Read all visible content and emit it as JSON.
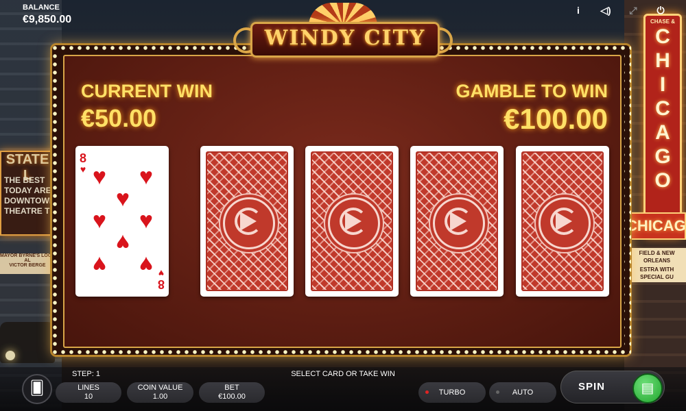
{
  "hud": {
    "balance_label": "BALANCE",
    "balance_value": "€9,850.00",
    "icons": [
      "info-icon",
      "sound-icon",
      "fullscreen-icon",
      "power-icon"
    ]
  },
  "game": {
    "title": "WINDY CITY",
    "current_win_label": "CURRENT WIN",
    "current_win_value": "€50.00",
    "gamble_label": "GAMBLE TO WIN",
    "gamble_value": "€100.00",
    "revealed_card": {
      "rank": "8",
      "suit": "hearts",
      "suit_symbol": "♥",
      "color": "#d9141c"
    },
    "hidden_cards": 4,
    "card_back_color": "#c0392b"
  },
  "background": {
    "left_sign": {
      "title": "STATE L",
      "lines": [
        "THE BEST",
        "TODAY ARE",
        "DOWNTOWN",
        "THEATRE T"
      ],
      "small": [
        "MAYOR BYRNE'S LOOP AL",
        "VICTOR BERGE"
      ]
    },
    "right_sign": {
      "chase": "CHASE &",
      "vertical": [
        "C",
        "H",
        "I",
        "C",
        "A",
        "G",
        "O"
      ],
      "horizontal": "CHICAGO",
      "small": [
        "FIELD & NEW ORLEANS",
        "ESTRA WITH SPECIAL GU"
      ]
    }
  },
  "controls": {
    "step_label": "STEP: 1",
    "prompt": "SELECT CARD OR TAKE WIN",
    "lines_label": "LINES",
    "lines_value": "10",
    "coin_label": "COIN VALUE",
    "coin_value": "1.00",
    "bet_label": "BET",
    "bet_value": "€100.00",
    "turbo_label": "TURBO",
    "auto_label": "AUTO",
    "spin_label": "SPIN"
  },
  "colors": {
    "gold": "#ffe066",
    "frame": "#d9a648",
    "felt": "#5c1d12",
    "spin_green": "#20a52d"
  }
}
